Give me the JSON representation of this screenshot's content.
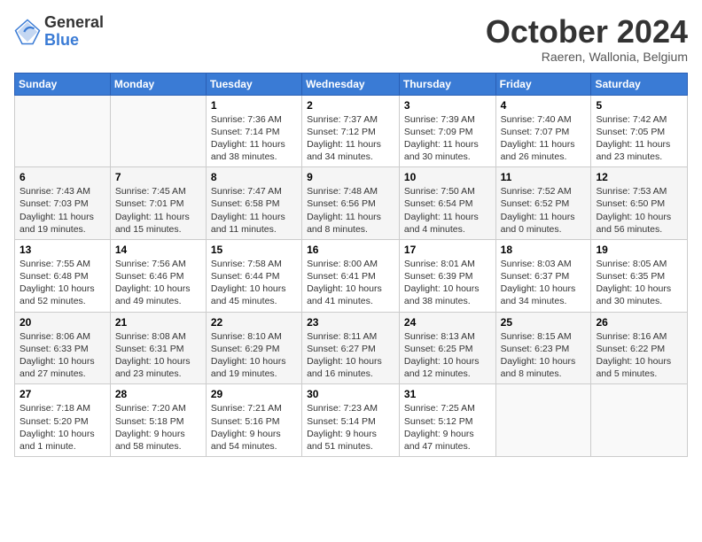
{
  "logo": {
    "general": "General",
    "blue": "Blue"
  },
  "title": "October 2024",
  "subtitle": "Raeren, Wallonia, Belgium",
  "days_of_week": [
    "Sunday",
    "Monday",
    "Tuesday",
    "Wednesday",
    "Thursday",
    "Friday",
    "Saturday"
  ],
  "weeks": [
    [
      {
        "day": "",
        "info": ""
      },
      {
        "day": "",
        "info": ""
      },
      {
        "day": "1",
        "info": "Sunrise: 7:36 AM\nSunset: 7:14 PM\nDaylight: 11 hours and 38 minutes."
      },
      {
        "day": "2",
        "info": "Sunrise: 7:37 AM\nSunset: 7:12 PM\nDaylight: 11 hours and 34 minutes."
      },
      {
        "day": "3",
        "info": "Sunrise: 7:39 AM\nSunset: 7:09 PM\nDaylight: 11 hours and 30 minutes."
      },
      {
        "day": "4",
        "info": "Sunrise: 7:40 AM\nSunset: 7:07 PM\nDaylight: 11 hours and 26 minutes."
      },
      {
        "day": "5",
        "info": "Sunrise: 7:42 AM\nSunset: 7:05 PM\nDaylight: 11 hours and 23 minutes."
      }
    ],
    [
      {
        "day": "6",
        "info": "Sunrise: 7:43 AM\nSunset: 7:03 PM\nDaylight: 11 hours and 19 minutes."
      },
      {
        "day": "7",
        "info": "Sunrise: 7:45 AM\nSunset: 7:01 PM\nDaylight: 11 hours and 15 minutes."
      },
      {
        "day": "8",
        "info": "Sunrise: 7:47 AM\nSunset: 6:58 PM\nDaylight: 11 hours and 11 minutes."
      },
      {
        "day": "9",
        "info": "Sunrise: 7:48 AM\nSunset: 6:56 PM\nDaylight: 11 hours and 8 minutes."
      },
      {
        "day": "10",
        "info": "Sunrise: 7:50 AM\nSunset: 6:54 PM\nDaylight: 11 hours and 4 minutes."
      },
      {
        "day": "11",
        "info": "Sunrise: 7:52 AM\nSunset: 6:52 PM\nDaylight: 11 hours and 0 minutes."
      },
      {
        "day": "12",
        "info": "Sunrise: 7:53 AM\nSunset: 6:50 PM\nDaylight: 10 hours and 56 minutes."
      }
    ],
    [
      {
        "day": "13",
        "info": "Sunrise: 7:55 AM\nSunset: 6:48 PM\nDaylight: 10 hours and 52 minutes."
      },
      {
        "day": "14",
        "info": "Sunrise: 7:56 AM\nSunset: 6:46 PM\nDaylight: 10 hours and 49 minutes."
      },
      {
        "day": "15",
        "info": "Sunrise: 7:58 AM\nSunset: 6:44 PM\nDaylight: 10 hours and 45 minutes."
      },
      {
        "day": "16",
        "info": "Sunrise: 8:00 AM\nSunset: 6:41 PM\nDaylight: 10 hours and 41 minutes."
      },
      {
        "day": "17",
        "info": "Sunrise: 8:01 AM\nSunset: 6:39 PM\nDaylight: 10 hours and 38 minutes."
      },
      {
        "day": "18",
        "info": "Sunrise: 8:03 AM\nSunset: 6:37 PM\nDaylight: 10 hours and 34 minutes."
      },
      {
        "day": "19",
        "info": "Sunrise: 8:05 AM\nSunset: 6:35 PM\nDaylight: 10 hours and 30 minutes."
      }
    ],
    [
      {
        "day": "20",
        "info": "Sunrise: 8:06 AM\nSunset: 6:33 PM\nDaylight: 10 hours and 27 minutes."
      },
      {
        "day": "21",
        "info": "Sunrise: 8:08 AM\nSunset: 6:31 PM\nDaylight: 10 hours and 23 minutes."
      },
      {
        "day": "22",
        "info": "Sunrise: 8:10 AM\nSunset: 6:29 PM\nDaylight: 10 hours and 19 minutes."
      },
      {
        "day": "23",
        "info": "Sunrise: 8:11 AM\nSunset: 6:27 PM\nDaylight: 10 hours and 16 minutes."
      },
      {
        "day": "24",
        "info": "Sunrise: 8:13 AM\nSunset: 6:25 PM\nDaylight: 10 hours and 12 minutes."
      },
      {
        "day": "25",
        "info": "Sunrise: 8:15 AM\nSunset: 6:23 PM\nDaylight: 10 hours and 8 minutes."
      },
      {
        "day": "26",
        "info": "Sunrise: 8:16 AM\nSunset: 6:22 PM\nDaylight: 10 hours and 5 minutes."
      }
    ],
    [
      {
        "day": "27",
        "info": "Sunrise: 7:18 AM\nSunset: 5:20 PM\nDaylight: 10 hours and 1 minute."
      },
      {
        "day": "28",
        "info": "Sunrise: 7:20 AM\nSunset: 5:18 PM\nDaylight: 9 hours and 58 minutes."
      },
      {
        "day": "29",
        "info": "Sunrise: 7:21 AM\nSunset: 5:16 PM\nDaylight: 9 hours and 54 minutes."
      },
      {
        "day": "30",
        "info": "Sunrise: 7:23 AM\nSunset: 5:14 PM\nDaylight: 9 hours and 51 minutes."
      },
      {
        "day": "31",
        "info": "Sunrise: 7:25 AM\nSunset: 5:12 PM\nDaylight: 9 hours and 47 minutes."
      },
      {
        "day": "",
        "info": ""
      },
      {
        "day": "",
        "info": ""
      }
    ]
  ]
}
